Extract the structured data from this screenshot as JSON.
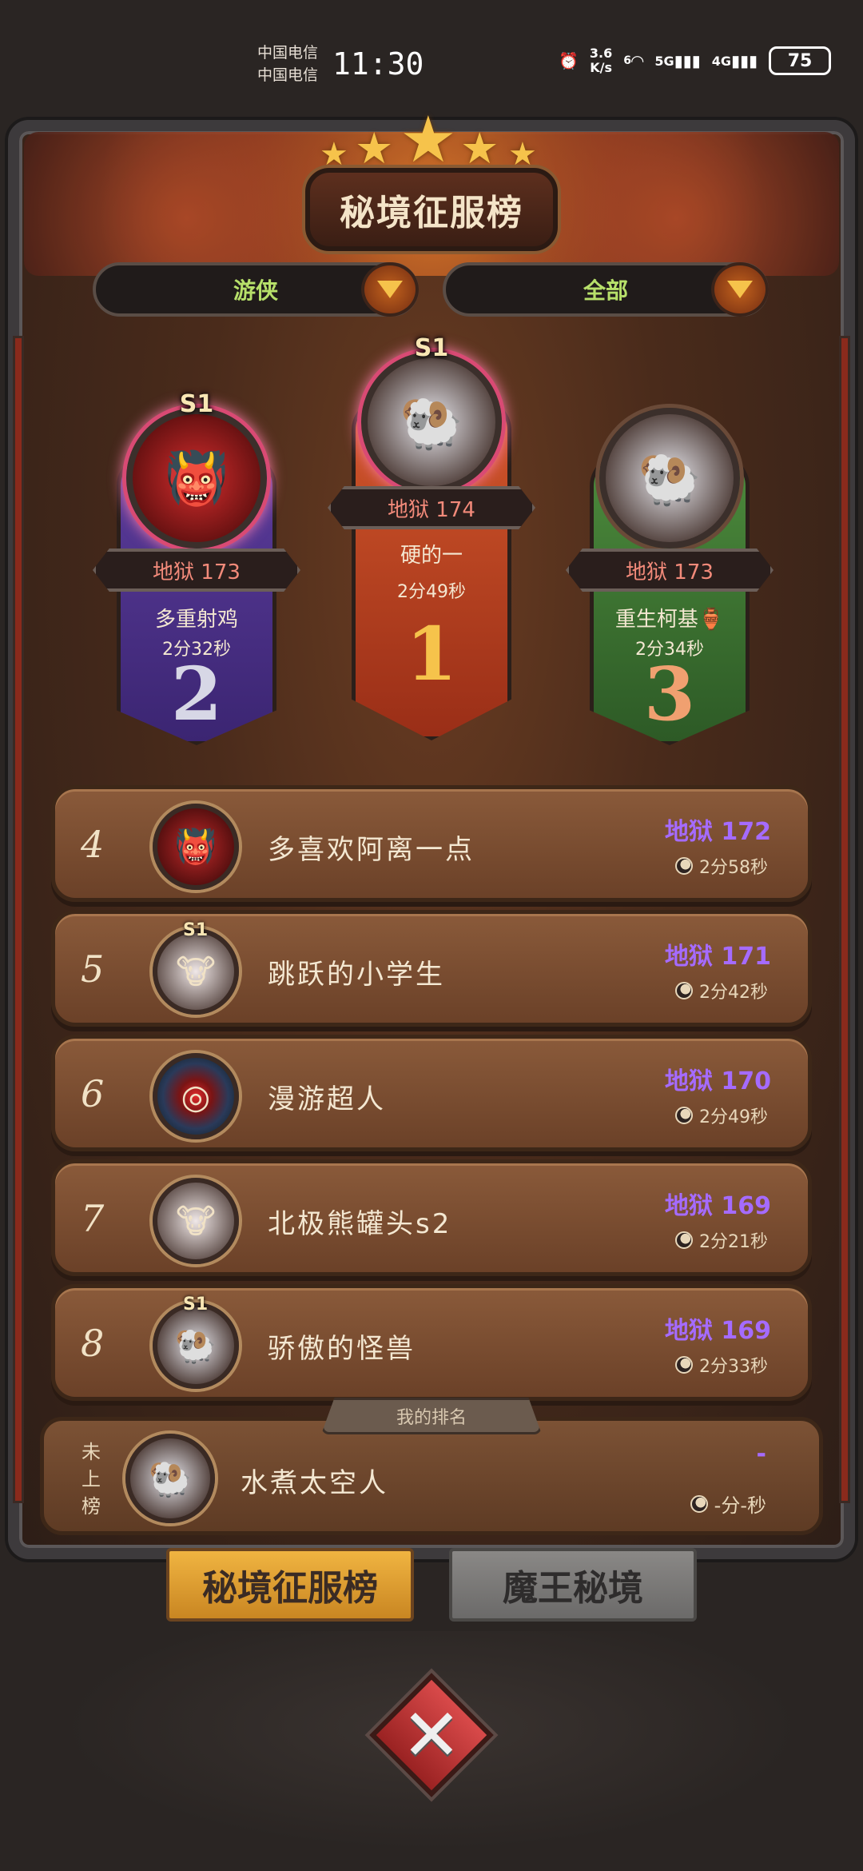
{
  "status_bar": {
    "carrier_1": "中国电信",
    "carrier_2": "中国电信",
    "time": "11:30",
    "net_speed_value": "3.6",
    "net_speed_unit": "K/s",
    "wifi_label": "6",
    "signal_1": "5G",
    "signal_2": "4G",
    "battery": "75"
  },
  "header": {
    "title": "秘境征服榜",
    "filter_class": "游侠",
    "filter_scope": "全部"
  },
  "podium": [
    {
      "rank": "1",
      "season": "S1",
      "level": "地狱 174",
      "name": "硬的一",
      "time": "2分49秒",
      "color": "#d2572b"
    },
    {
      "rank": "2",
      "season": "S1",
      "level": "地狱 173",
      "name": "多重射鸡",
      "time": "2分32秒",
      "color": "#5b3c9b"
    },
    {
      "rank": "3",
      "season": "",
      "level": "地狱 173",
      "name": "重生柯基🏺",
      "time": "2分34秒",
      "color": "#4c8a3c"
    }
  ],
  "list": [
    {
      "rank": "4",
      "name": "多喜欢阿离一点",
      "level": "地狱 172",
      "time": "2分58秒",
      "avatar_icon": "demon-avatar-icon"
    },
    {
      "rank": "5",
      "name": "跳跃的小学生",
      "level": "地狱 171",
      "time": "2分42秒",
      "avatar_icon": "cow-avatar-icon",
      "season": "S1"
    },
    {
      "rank": "6",
      "name": "漫游超人",
      "level": "地狱 170",
      "time": "2分49秒",
      "avatar_icon": "eye-avatar-icon"
    },
    {
      "rank": "7",
      "name": "北极熊罐头s2",
      "level": "地狱 169",
      "time": "2分21秒",
      "avatar_icon": "cow-avatar-icon"
    },
    {
      "rank": "8",
      "name": "骄傲的怪兽",
      "level": "地狱 169",
      "time": "2分33秒",
      "avatar_icon": "sheep-avatar-icon",
      "season": "S1"
    }
  ],
  "my_rank": {
    "tab_label": "我的排名",
    "rank_text": "未上榜",
    "name": "水煮太空人",
    "level": "-",
    "time": "-分-秒"
  },
  "bottom_tabs": {
    "active": "秘境征服榜",
    "inactive": "魔王秘境"
  },
  "colors": {
    "accent_gold": "#f6c34b",
    "level_purple": "#a56bff",
    "filter_green": "#b7e06a"
  }
}
